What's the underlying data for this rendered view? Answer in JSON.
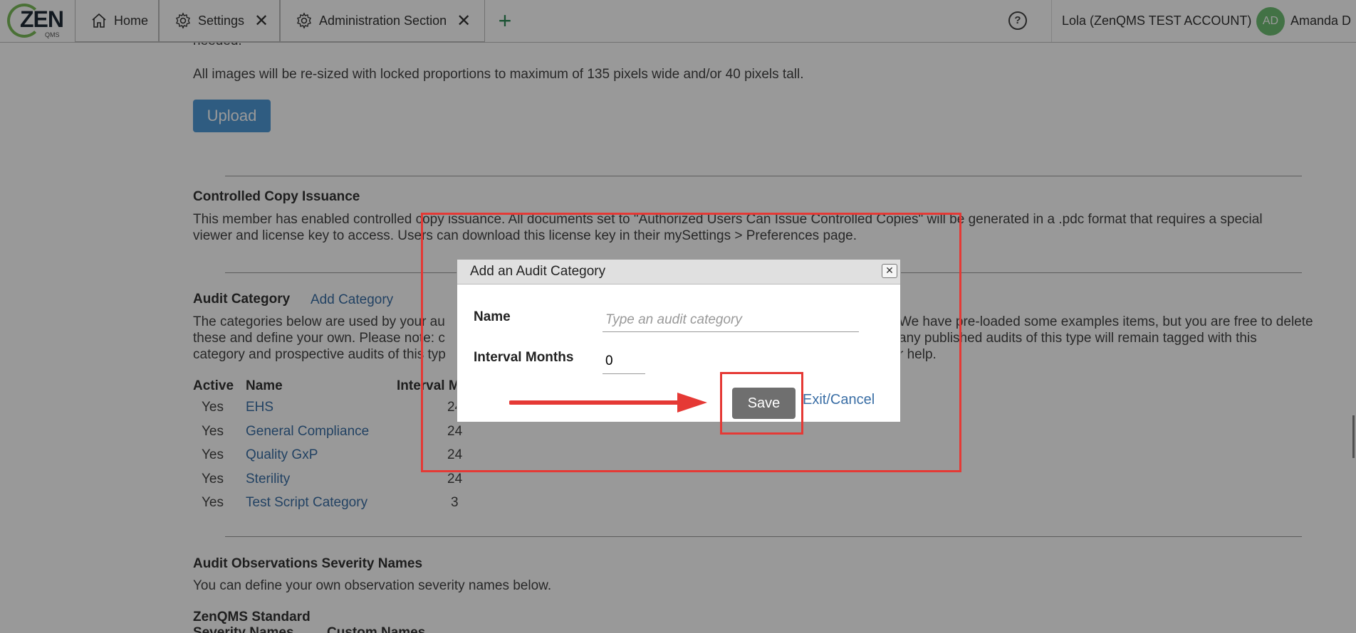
{
  "topbar": {
    "logo_text": "ZEN",
    "logo_sub": "QMS",
    "tabs": [
      {
        "label": "Home",
        "icon": "home-icon"
      },
      {
        "label": "Settings",
        "icon": "gear-icon"
      },
      {
        "label": "Administration Section",
        "icon": "gear-icon"
      }
    ],
    "close_glyph": "✕",
    "add_glyph": "+",
    "help_glyph": "?",
    "account": "Lola (ZenQMS TEST ACCOUNT)",
    "avatar_initials": "AD",
    "username": "Amanda D"
  },
  "content": {
    "cut_text": "needed.",
    "resize_note": "All images will be re-sized with locked proportions to maximum of 135 pixels wide and/or 40 pixels tall.",
    "upload_label": "Upload",
    "cci_title": "Controlled Copy Issuance",
    "cci_text_1": "This member has enabled controlled copy issuance. All documents set to \"Authorized Users Can Issue Controlled Copies\" will be generated in a .pdc format that requires a special",
    "cci_text_2": "viewer and license key to access. Users can download this license key in their mySettings > Preferences page.",
    "audit_title": "Audit Category",
    "add_category": "Add Category",
    "audit_text_1a": "The categories below are used by your au",
    "audit_text_1b": "We have pre-loaded some examples items, but you are free to delete",
    "audit_text_2a": "these and define your own. Please note: c",
    "audit_text_2b": "any published audits of this type will remain tagged with this",
    "audit_text_3a": "category and prospective audits of this typ",
    "audit_text_3b": "r help.",
    "table_headers": {
      "active": "Active",
      "name": "Name",
      "interval": "Interval M"
    },
    "rows": [
      {
        "active": "Yes",
        "name": "EHS",
        "interval": "24"
      },
      {
        "active": "Yes",
        "name": "General Compliance",
        "interval": "24"
      },
      {
        "active": "Yes",
        "name": "Quality GxP",
        "interval": "24"
      },
      {
        "active": "Yes",
        "name": "Sterility",
        "interval": "24"
      },
      {
        "active": "Yes",
        "name": "Test Script Category",
        "interval": "3"
      }
    ],
    "severity_title": "Audit Observations Severity Names",
    "severity_text": "You can define your own observation severity names below.",
    "standard_title": "ZenQMS Standard",
    "severity_col": "Severity Names",
    "custom_col": "Custom Names"
  },
  "dialog": {
    "title": "Add an Audit Category",
    "close_glyph": "✕",
    "name_label": "Name",
    "name_value": "",
    "name_placeholder": "Type an audit category",
    "interval_label": "Interval Months",
    "interval_value": "0",
    "save_label": "Save",
    "exit_label": "Exit/Cancel"
  },
  "colors": {
    "accent": "#3a6ea5",
    "upload_button": "#4f9ad8",
    "save_button": "#6f6f6f",
    "annotation": "#e53935",
    "avatar": "#6fbf73"
  }
}
